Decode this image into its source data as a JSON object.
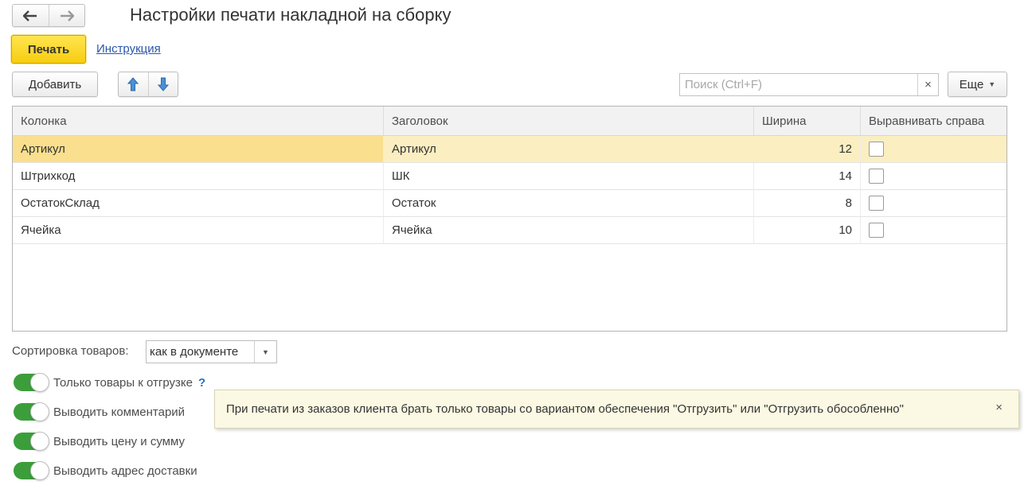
{
  "header": {
    "title": "Настройки печати накладной на сборку",
    "back_icon": "arrow-left-icon",
    "forward_icon": "arrow-right-icon"
  },
  "command_bar": {
    "print_label": "Печать",
    "help_link": "Инструкция"
  },
  "toolbar": {
    "add_label": "Добавить",
    "move_up_icon": "arrow-up-icon",
    "move_down_icon": "arrow-down-icon",
    "search_placeholder": "Поиск (Ctrl+F)",
    "search_value": "",
    "clear_glyph": "×",
    "more_label": "Еще",
    "more_caret": "▼"
  },
  "table": {
    "columns": [
      "Колонка",
      "Заголовок",
      "Ширина",
      "Выравнивать справа"
    ],
    "rows": [
      {
        "column": "Артикул",
        "header": "Артикул",
        "width": "12",
        "align_right": false,
        "selected": true
      },
      {
        "column": "Штрихкод",
        "header": "ШК",
        "width": "14",
        "align_right": false,
        "selected": false
      },
      {
        "column": "ОстатокСклад",
        "header": "Остаток",
        "width": "8",
        "align_right": false,
        "selected": false
      },
      {
        "column": "Ячейка",
        "header": "Ячейка",
        "width": "10",
        "align_right": false,
        "selected": false
      }
    ]
  },
  "form": {
    "sort_label": "Сортировка товаров:",
    "sort_value": "как в документе",
    "sort_caret": "▼",
    "toggles": [
      {
        "label": "Только товары к отгрузке",
        "on": true,
        "help": "?"
      },
      {
        "label": "Выводить комментарий",
        "on": true
      },
      {
        "label": "Выводить цену и сумму",
        "on": true
      },
      {
        "label": "Выводить адрес доставки",
        "on": true
      }
    ]
  },
  "tooltip": {
    "text": "При печати из заказов клиента брать только товары со вариантом обеспечения \"Отгрузить\" или \"Отгрузить обособленно\"",
    "close_glyph": "×"
  },
  "colors": {
    "accent_print": "#f7cd10",
    "toggle_on": "#3b9e3b",
    "row_selected": "#fbeec1",
    "link": "#2a57a8"
  }
}
